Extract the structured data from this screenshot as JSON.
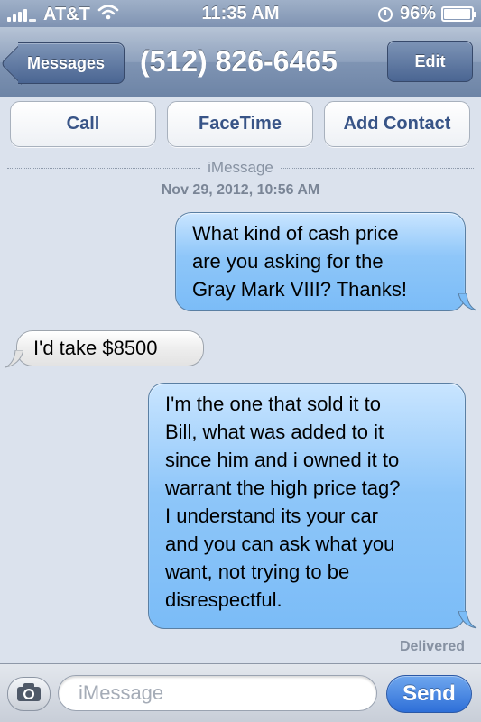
{
  "status_bar": {
    "carrier": "AT&T",
    "time": "11:35 AM",
    "battery_percent": "96%",
    "battery_level": 0.96,
    "icons": [
      "signal-icon",
      "wifi-icon",
      "alarm-clock-icon",
      "battery-icon"
    ]
  },
  "nav": {
    "back_label": "Messages",
    "title": "(512) 826-6465",
    "edit_label": "Edit"
  },
  "actions": {
    "call_label": "Call",
    "facetime_label": "FaceTime",
    "add_contact_label": "Add Contact"
  },
  "conversation": {
    "service_label": "iMessage",
    "timestamp": "Nov 29, 2012, 10:56 AM",
    "messages": [
      {
        "direction": "outgoing",
        "lines": [
          "What kind of cash price",
          "are you asking for the",
          "Gray Mark VIII? Thanks!"
        ]
      },
      {
        "direction": "incoming",
        "lines": [
          "I'd take $8500"
        ]
      },
      {
        "direction": "outgoing",
        "lines": [
          "I'm the one that sold it to",
          "Bill, what was added to it",
          "since him and i owned it to",
          "warrant the high price tag?",
          "I understand its your car",
          "and you can ask what you",
          "want, not trying to be",
          "disrespectful."
        ]
      }
    ],
    "delivery_status": "Delivered"
  },
  "composer": {
    "placeholder": "iMessage",
    "value": "",
    "send_label": "Send",
    "camera_icon": "camera-icon"
  },
  "colors": {
    "nav_bar": "#7f94b3",
    "outgoing_bubble": "#8ec6f9",
    "incoming_bubble": "#eeeeee",
    "send_button": "#2e6fd8",
    "background": "#dbe2ed"
  }
}
